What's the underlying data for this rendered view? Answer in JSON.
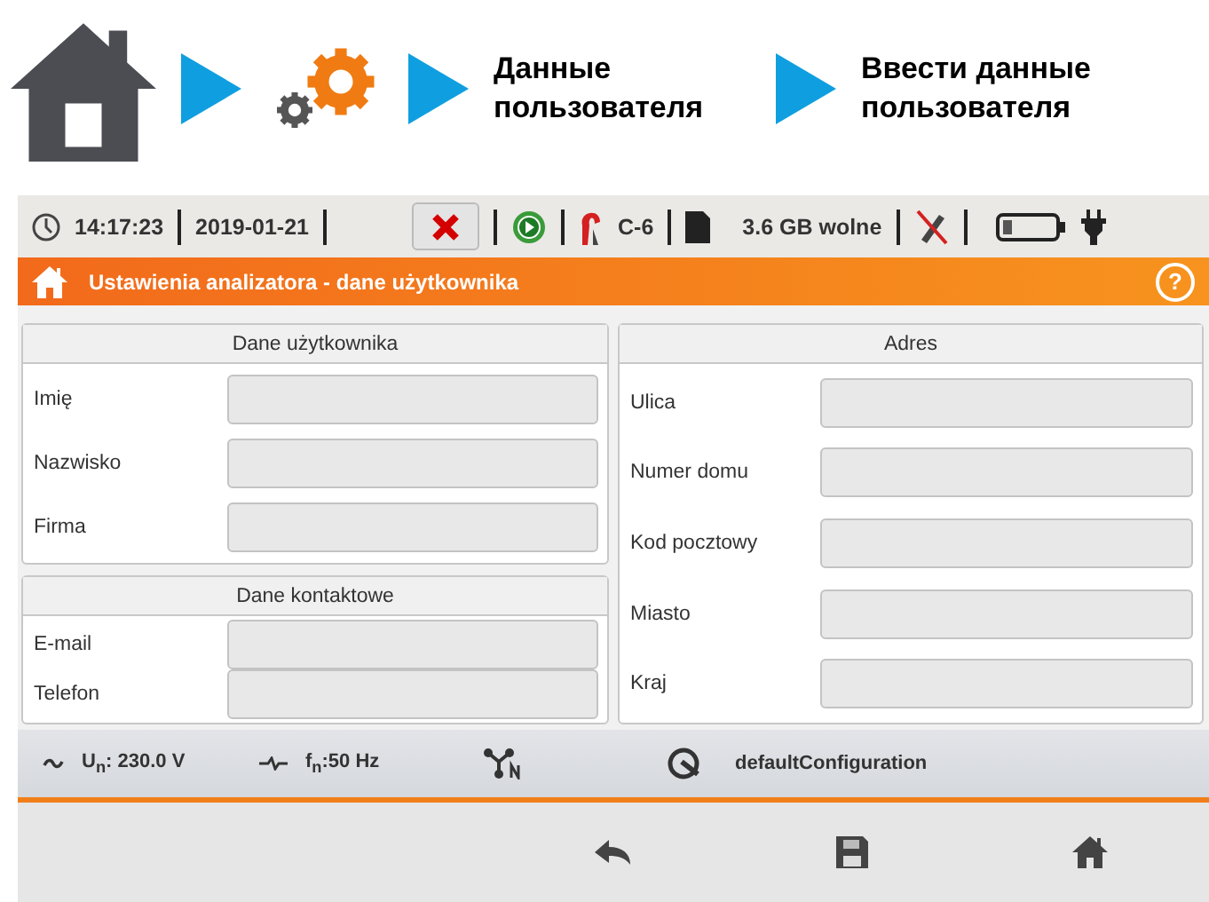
{
  "breadcrumb": [
    {
      "kind": "home"
    },
    {
      "kind": "gear"
    },
    {
      "kind": "text",
      "label": "Данные пользователя"
    },
    {
      "kind": "text",
      "label": "Ввести данные пользователя"
    }
  ],
  "status_bar": {
    "time": "14:17:23",
    "date": "2019-01-21",
    "clamp": "C-6",
    "storage": "3.6 GB wolne"
  },
  "header": {
    "title": "Ustawienia analizatora - dane użytkownika",
    "help": "?"
  },
  "panels": [
    {
      "title": "Dane użytkownika",
      "fields": [
        {
          "label": "Imię"
        },
        {
          "label": "Nazwisko"
        },
        {
          "label": "Firma"
        }
      ]
    },
    {
      "title": "Dane kontaktowe",
      "fields": [
        {
          "label": "E-mail"
        },
        {
          "label": "Telefon"
        }
      ]
    },
    {
      "title": "Adres",
      "fields": [
        {
          "label": "Ulica"
        },
        {
          "label": "Numer domu"
        },
        {
          "label": "Kod pocztowy"
        },
        {
          "label": "Miasto"
        },
        {
          "label": "Kraj"
        }
      ]
    }
  ],
  "footer": {
    "voltage": "U$_{n}$: 230.0 V",
    "frequency": "f$_{n}$:50 Hz",
    "config": "defaultConfiguration"
  }
}
